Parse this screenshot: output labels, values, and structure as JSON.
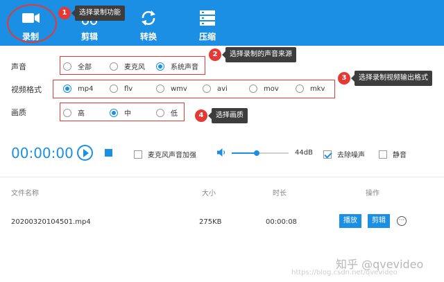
{
  "toolbar": {
    "items": [
      {
        "label": "录制",
        "icon": "camera-icon"
      },
      {
        "label": "剪辑",
        "icon": "scissors-icon"
      },
      {
        "label": "转换",
        "icon": "convert-icon"
      },
      {
        "label": "压缩",
        "icon": "compress-icon"
      }
    ]
  },
  "annotations": [
    {
      "number": "1",
      "text": "选择录制功能"
    },
    {
      "number": "2",
      "text": "选择录制的声音来源"
    },
    {
      "number": "3",
      "text": "选择录制视频输出格式"
    },
    {
      "number": "4",
      "text": "选择画质"
    }
  ],
  "settings": {
    "sound": {
      "label": "声音",
      "options": [
        "全部",
        "麦克风",
        "系统声音"
      ],
      "selected": "系统声音"
    },
    "format": {
      "label": "视频格式",
      "options": [
        "mp4",
        "flv",
        "wmv",
        "avi",
        "mov",
        "mkv"
      ],
      "selected": "mp4"
    },
    "quality": {
      "label": "画质",
      "options": [
        "高",
        "中",
        "低"
      ],
      "selected": "中"
    }
  },
  "player": {
    "timer": "00:00:00",
    "mic_boost_label": "麦克风声音加强",
    "mic_boost_checked": false,
    "volume_value": "44dB",
    "volume_fraction": 0.44,
    "denoise_label": "去除噪声",
    "denoise_checked": true,
    "mute_label": "静音",
    "mute_checked": false
  },
  "files": {
    "headers": {
      "name": "文件名称",
      "size": "大小",
      "duration": "时长",
      "actions": "操作"
    },
    "rows": [
      {
        "name": "20200320104501.mp4",
        "size": "275KB",
        "duration": "00:00:08",
        "play_label": "播放",
        "edit_label": "剪辑",
        "more": "···"
      }
    ]
  },
  "watermark": {
    "text": "知乎 @qvevideo",
    "url": "https://blog.csdn.net/qvevideo"
  },
  "colors": {
    "accent": "#1a8fe3",
    "annotation": "#e53935",
    "tooltip": "#3d3d3d"
  }
}
